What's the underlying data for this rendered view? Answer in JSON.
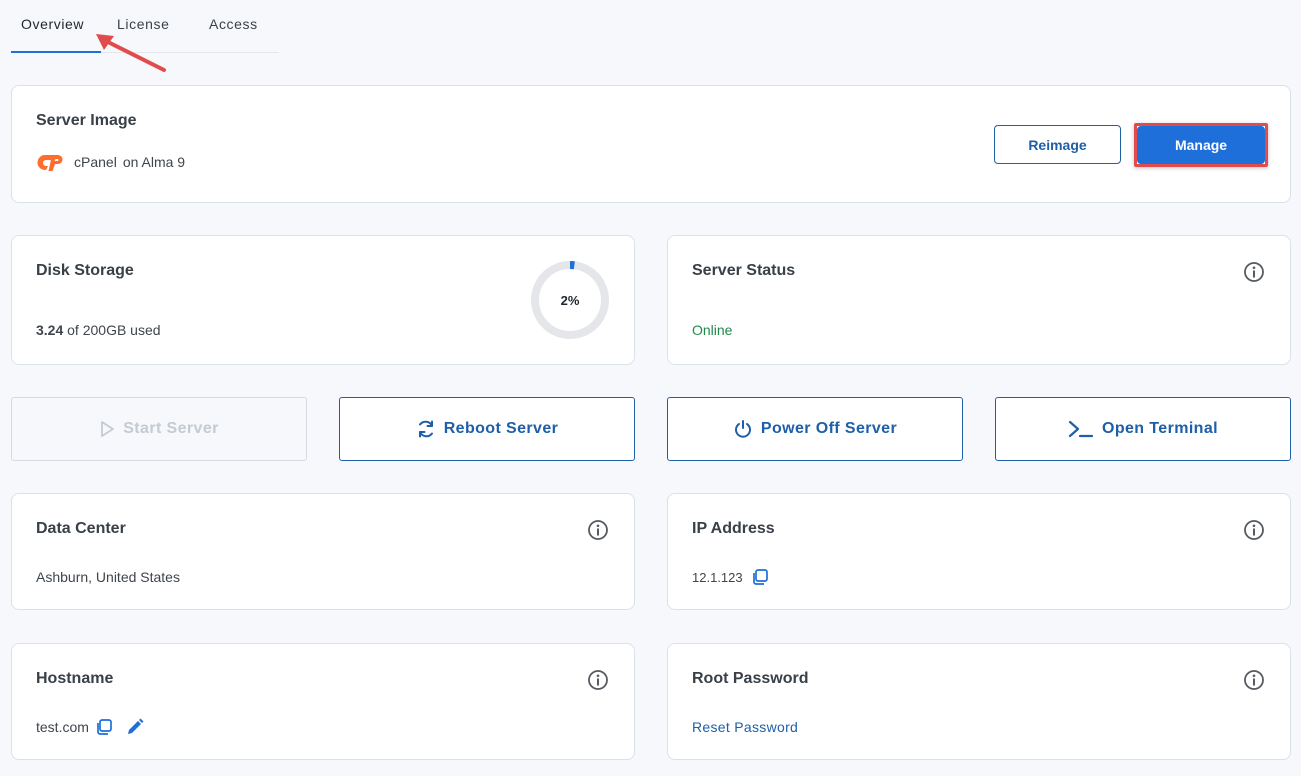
{
  "tabs": [
    {
      "label": "Overview"
    },
    {
      "label": "License"
    },
    {
      "label": "Access"
    }
  ],
  "server_image": {
    "title": "Server Image",
    "panel_name": "cPanel",
    "os_text": "on Alma 9",
    "reimage_label": "Reimage",
    "manage_label": "Manage"
  },
  "disk": {
    "title": "Disk Storage",
    "used": "3.24",
    "of_text": "of 200GB used",
    "percent_label": "2%",
    "percent_value": 2
  },
  "status": {
    "title": "Server Status",
    "value": "Online"
  },
  "actions": {
    "start": "Start Server",
    "reboot": "Reboot Server",
    "power_off": "Power Off Server",
    "terminal": "Open Terminal"
  },
  "data_center": {
    "title": "Data Center",
    "value": "Ashburn, United States"
  },
  "ip": {
    "title": "IP Address",
    "value": "12.1.123"
  },
  "hostname": {
    "title": "Hostname",
    "value": "test.com"
  },
  "root_password": {
    "title": "Root Password",
    "link": "Reset Password"
  },
  "colors": {
    "accent": "#1e6fd9",
    "outline": "#1e5fa8",
    "online": "#1f8a4a",
    "highlight": "#e24b4b",
    "cpanel": "#ff6c2c"
  }
}
